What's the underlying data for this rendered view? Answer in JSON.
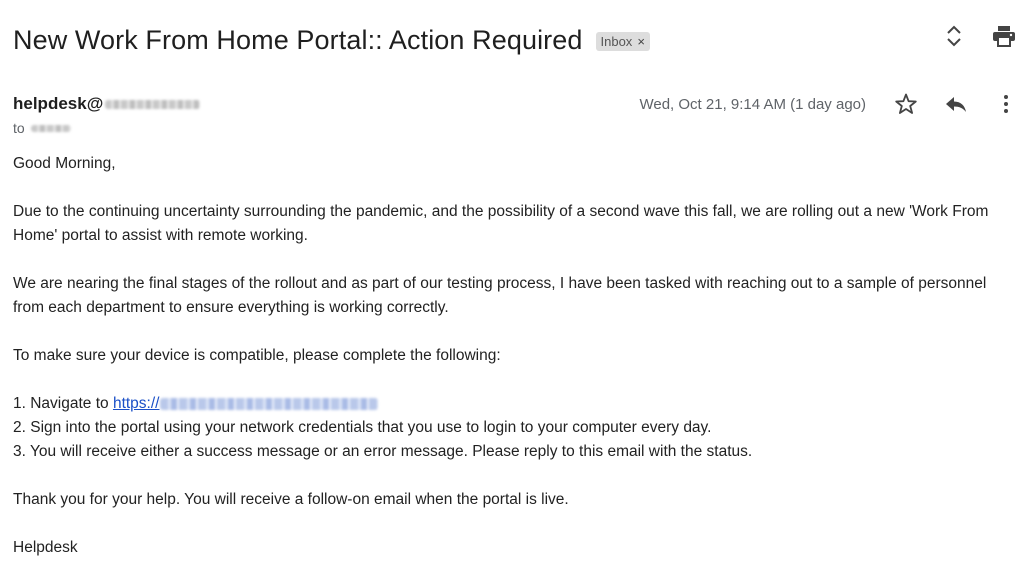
{
  "header": {
    "subject": "New Work From Home Portal:: Action Required",
    "label": "Inbox",
    "label_close": "×",
    "icons": {
      "expand": "unfold-icon",
      "print": "print-icon"
    }
  },
  "message": {
    "sender_prefix": "helpdesk@",
    "date": "Wed, Oct 21, 9:14 AM (1 day ago)",
    "to_label": "to",
    "icons": {
      "star": "star-icon",
      "reply": "reply-icon",
      "more": "more-vert-icon"
    }
  },
  "body": {
    "greeting": "Good Morning,",
    "para1": "Due to the continuing uncertainty surrounding the pandemic, and the possibility of a second wave this fall, we are rolling out a new 'Work From Home' portal to assist with remote working.",
    "para2": "We are nearing the final stages of the rollout and as part of our testing process, I have been tasked with reaching out to a sample of personnel from each department to ensure everything is working correctly.",
    "para3": "To make sure your device is compatible, please complete the following:",
    "step1_prefix": "1. Navigate to ",
    "step1_link": "https://",
    "step2": "2. Sign into the portal using your network credentials that you use to login to your computer every day.",
    "step3": "3. You will receive either a success message or an error message. Please reply to this email with the status.",
    "para4": "Thank you for your help. You will receive a follow-on email when the portal is live.",
    "signature": "Helpdesk"
  },
  "colors": {
    "link": "#1a4fc7",
    "chip_bg": "#dddddd",
    "muted": "#5f6368"
  }
}
